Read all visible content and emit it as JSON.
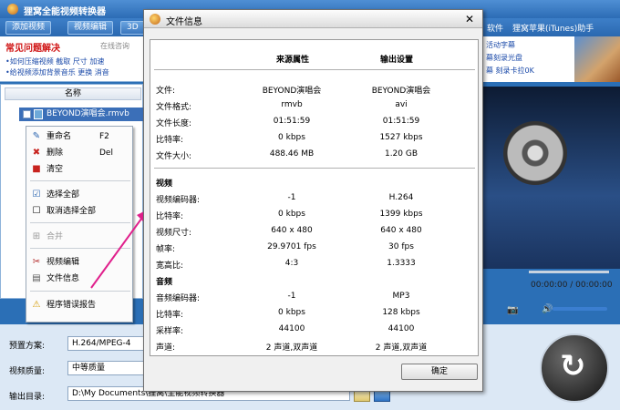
{
  "window": {
    "title": "狸窝全能视频转换器"
  },
  "toolbar": {
    "add_video": "添加视频",
    "edit_video": "视频编辑",
    "btn_3d": "3D",
    "link_software": "软件",
    "link_itunes": "狸窝苹果(iTunes)助手"
  },
  "faq": {
    "title": "常见问题解决",
    "online_help": "在线咨询",
    "line1": "•如何压缩视频 截取 尺寸 加速",
    "line2": "•给视频添加背景音乐 更换 消音"
  },
  "banner": {
    "line1": "活动字幕",
    "line2": "幕刻录光盘",
    "line3": "幕 刻录卡拉0K"
  },
  "file_list": {
    "header": "名称",
    "row_name": "BEYOND演唱会.rmvb"
  },
  "context_menu": {
    "rename": "重命名",
    "rename_key": "F2",
    "delete": "删除",
    "delete_key": "Del",
    "clear": "清空",
    "select_all": "选择全部",
    "deselect_all": "取消选择全部",
    "merge": "合并",
    "video_edit": "视频编辑",
    "file_info": "文件信息",
    "error_report": "程序错误报告"
  },
  "settings": {
    "preset_label": "预置方案:",
    "preset_value": "H.264/MPEG-4",
    "quality_label": "视频质量:",
    "quality_value": "中等质量",
    "output_label": "输出目录:",
    "output_value": "D:\\My Documents\\狸窝\\全能视频转换器"
  },
  "player": {
    "time": "00:00:00 / 00:00:00"
  },
  "dialog": {
    "title": "文件信息",
    "col_source": "来源属性",
    "col_output": "输出设置",
    "general": [
      {
        "label": "文件:",
        "src": "BEYOND演唱会",
        "out": "BEYOND演唱会"
      },
      {
        "label": "文件格式:",
        "src": "rmvb",
        "out": "avi"
      },
      {
        "label": "文件长度:",
        "src": "01:51:59",
        "out": "01:51:59"
      },
      {
        "label": "比特率:",
        "src": "0 kbps",
        "out": "1527 kbps"
      },
      {
        "label": "文件大小:",
        "src": "488.46 MB",
        "out": "1.20 GB"
      }
    ],
    "video_section": "视频",
    "video": [
      {
        "label": "视频编码器:",
        "src": "-1",
        "out": "H.264"
      },
      {
        "label": "比特率:",
        "src": "0 kbps",
        "out": "1399 kbps"
      },
      {
        "label": "视频尺寸:",
        "src": "640 x 480",
        "out": "640 x 480"
      },
      {
        "label": "帧率:",
        "src": "29.9701 fps",
        "out": "30 fps"
      },
      {
        "label": "宽高比:",
        "src": "4:3",
        "out": "1.3333"
      }
    ],
    "audio_section": "音频",
    "audio": [
      {
        "label": "音频编码器:",
        "src": "-1",
        "out": "MP3"
      },
      {
        "label": "比特率:",
        "src": "0 kbps",
        "out": "128 kbps"
      },
      {
        "label": "采样率:",
        "src": "44100",
        "out": "44100"
      },
      {
        "label": "声道:",
        "src": "2 声道,双声道",
        "out": "2 声道,双声道"
      }
    ],
    "ok": "确定"
  },
  "colors": {
    "accent": "#2c6cb5",
    "selection": "#3b6fb8",
    "pointer": "#e0208c"
  }
}
